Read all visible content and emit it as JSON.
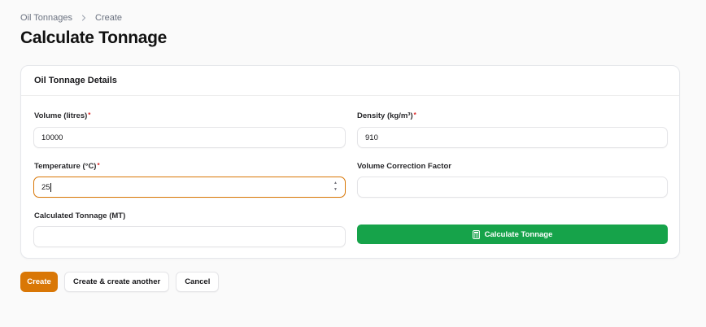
{
  "breadcrumb": {
    "items": [
      "Oil Tonnages",
      "Create"
    ]
  },
  "page": {
    "title": "Calculate Tonnage"
  },
  "form": {
    "section_title": "Oil Tonnage Details",
    "fields": {
      "volume": {
        "label": "Volume (litres)",
        "required_mark": "*",
        "value": "10000"
      },
      "density": {
        "label": "Density (kg/m³)",
        "required_mark": "*",
        "value": "910"
      },
      "temperature": {
        "label": "Temperature (°C)",
        "required_mark": "*",
        "value": "25"
      },
      "vcf": {
        "label": "Volume Correction Factor",
        "value": ""
      },
      "tonnage": {
        "label": "Calculated Tonnage (MT)",
        "value": ""
      }
    },
    "calculate_button": {
      "label": "Calculate Tonnage",
      "icon": "calculator-icon",
      "color": "#16a34a"
    }
  },
  "actions": {
    "create": "Create",
    "create_another": "Create & create another",
    "cancel": "Cancel",
    "primary_color": "#d97706"
  }
}
